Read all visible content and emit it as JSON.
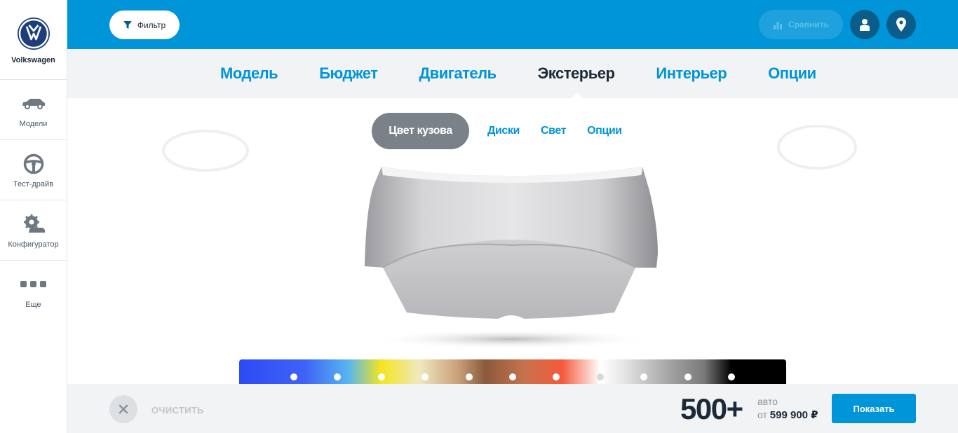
{
  "brand": {
    "name": "Volkswagen",
    "logo": "vw-logo"
  },
  "sidebar": {
    "items": [
      {
        "label": "Модели",
        "icon": "car-icon"
      },
      {
        "label": "Тест-драйв",
        "icon": "steering-wheel-icon"
      },
      {
        "label": "Конфигуратор",
        "icon": "configurator-gear-car-icon"
      },
      {
        "label": "Еще",
        "icon": "more-dots-icon"
      }
    ]
  },
  "topbar": {
    "filter_label": "Фильтр",
    "compare_label": "Сравнить",
    "background": "#0094d8"
  },
  "mainnav": {
    "items": [
      "Модель",
      "Бюджет",
      "Двигатель",
      "Экстерьер",
      "Интерьер",
      "Опции"
    ],
    "active": "Экстерьер"
  },
  "subtabs": {
    "items": [
      "Цвет кузова",
      "Диски",
      "Свет",
      "Опции"
    ],
    "active": "Цвет кузова"
  },
  "color_swatches": [
    "blue",
    "light-blue",
    "yellow",
    "beige",
    "brown",
    "copper",
    "red",
    "white",
    "silver",
    "grey",
    "black"
  ],
  "bottombar": {
    "clear_label": "ОЧИСТИТЬ",
    "count": "500+",
    "count_unit": "авто",
    "price_prefix": "от",
    "price": "599 900 ₽",
    "show_label": "Показать"
  },
  "colors": {
    "accent": "#0094d8",
    "dark": "#1b2a38",
    "active_tab": "#7a8189"
  }
}
